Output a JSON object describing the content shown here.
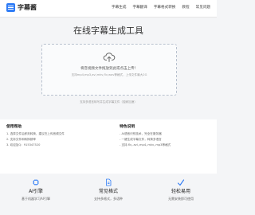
{
  "header": {
    "logo_text": "字幕酱",
    "nav": [
      "字幕生成",
      "字幕翻译",
      "字幕格式转换",
      "教程",
      "常见问题"
    ]
  },
  "main": {
    "title": "在线字幕生成工具"
  },
  "upload": {
    "main_text": "将音视频文件拖放到此或点击上传！",
    "sub_text": "支持mp4,mp3,avi,mkv,flv,wav等格式，上传文件最大2G",
    "icon": "cloud-upload-icon"
  },
  "tip": "支持多语言转写并生成字幕文件（独家加速）",
  "help": {
    "left_title": "使用帮助",
    "left_items": [
      "1. 选择文件后即刻转换，建议在上传音频文件",
      "2. 支持文件和转换频率",
      "3. 欢迎加Q：915347520"
    ],
    "right_title": "特色说明",
    "right_items": [
      "- AI语音识别技术，完全在服务器",
      "- 一键生成字幕文件，转换多语言",
      "- 支持.flv,.avi,.mp4,.mkv,.mp3等格式"
    ]
  },
  "features": [
    {
      "title": "AI引擎",
      "desc": "基于机器学习AI引擎",
      "icon": "ai-chip-icon"
    },
    {
      "title": "常见格式",
      "desc": "支持多格式，多语种",
      "icon": "format-icon"
    },
    {
      "title": "轻松易用",
      "desc": "无需安装即可使用",
      "icon": "easy-use-icon"
    }
  ],
  "colors": {
    "accent": "#2f7cf6",
    "background": "#f4f5f7"
  }
}
